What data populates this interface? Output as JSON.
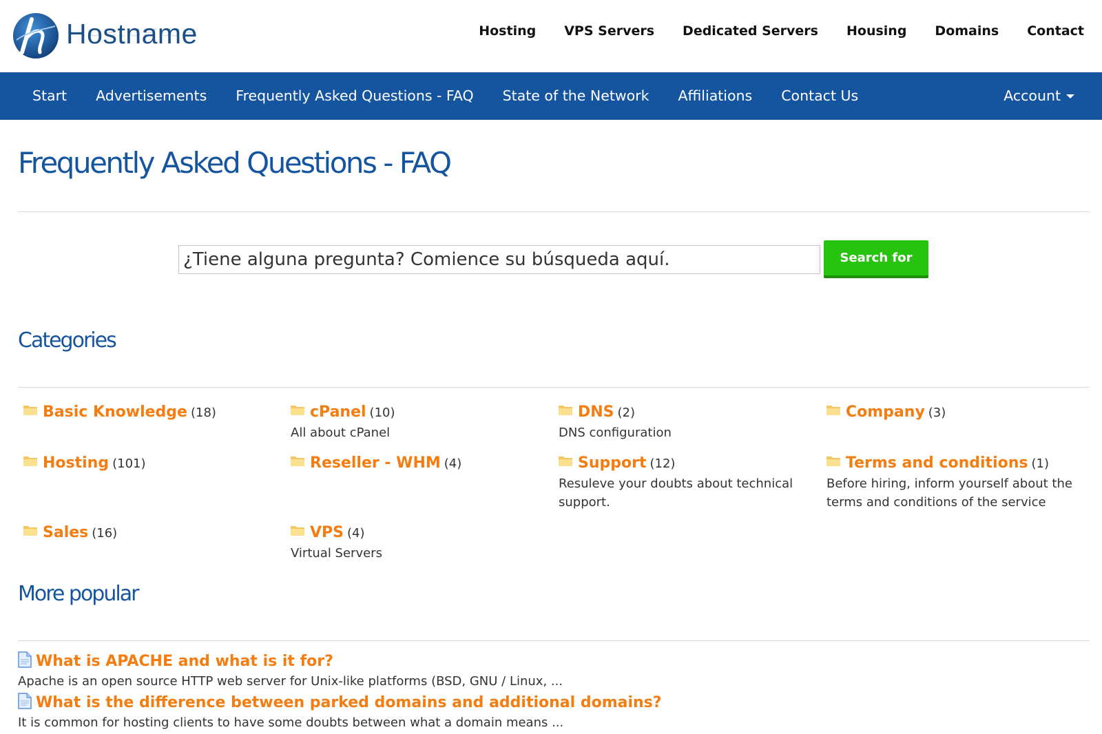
{
  "brand": {
    "name": "Hostname",
    "reflection": "Hostname"
  },
  "top_nav": [
    "Hosting",
    "VPS Servers",
    "Dedicated Servers",
    "Housing",
    "Domains",
    "Contact"
  ],
  "main_nav": {
    "items": [
      "Start",
      "Advertisements",
      "Frequently Asked Questions - FAQ",
      "State of the Network",
      "Affiliations",
      "Contact Us"
    ],
    "account_label": "Account"
  },
  "page": {
    "title": "Frequently Asked Questions - FAQ"
  },
  "search": {
    "placeholder": "¿Tiene alguna pregunta? Comience su búsqueda aquí.",
    "button_label": "Search for"
  },
  "categories": {
    "heading": "Categories",
    "items": [
      {
        "name": "Basic Knowledge",
        "count": "(18)",
        "desc": ""
      },
      {
        "name": "cPanel",
        "count": "(10)",
        "desc": "All about cPanel"
      },
      {
        "name": "DNS",
        "count": "(2)",
        "desc": "DNS configuration"
      },
      {
        "name": "Company",
        "count": "(3)",
        "desc": ""
      },
      {
        "name": "Hosting",
        "count": "(101)",
        "desc": ""
      },
      {
        "name": "Reseller - WHM",
        "count": "(4)",
        "desc": ""
      },
      {
        "name": "Support",
        "count": "(12)",
        "desc": "Resuleve your doubts about technical support."
      },
      {
        "name": "Terms and conditions",
        "count": "(1)",
        "desc": "Before hiring, inform yourself about the terms and conditions of the service"
      },
      {
        "name": "Sales",
        "count": "(16)",
        "desc": ""
      },
      {
        "name": "VPS",
        "count": "(4)",
        "desc": "Virtual Servers"
      }
    ]
  },
  "popular": {
    "heading": "More popular",
    "items": [
      {
        "question": "What is APACHE and what is it for?",
        "snippet": "Apache is an open source HTTP web server for Unix-like platforms (BSD, GNU / Linux, ..."
      },
      {
        "question": "What is the difference between parked domains and additional domains?",
        "snippet": "It is common for hosting clients to have some doubts between what a domain means ..."
      }
    ]
  },
  "colors": {
    "nav_blue": "#15559f",
    "accent_orange": "#f47d12",
    "button_green": "#27c30e"
  },
  "icons": {
    "folder": "folder-icon",
    "document": "document-icon",
    "caret": "caret-down-icon"
  }
}
